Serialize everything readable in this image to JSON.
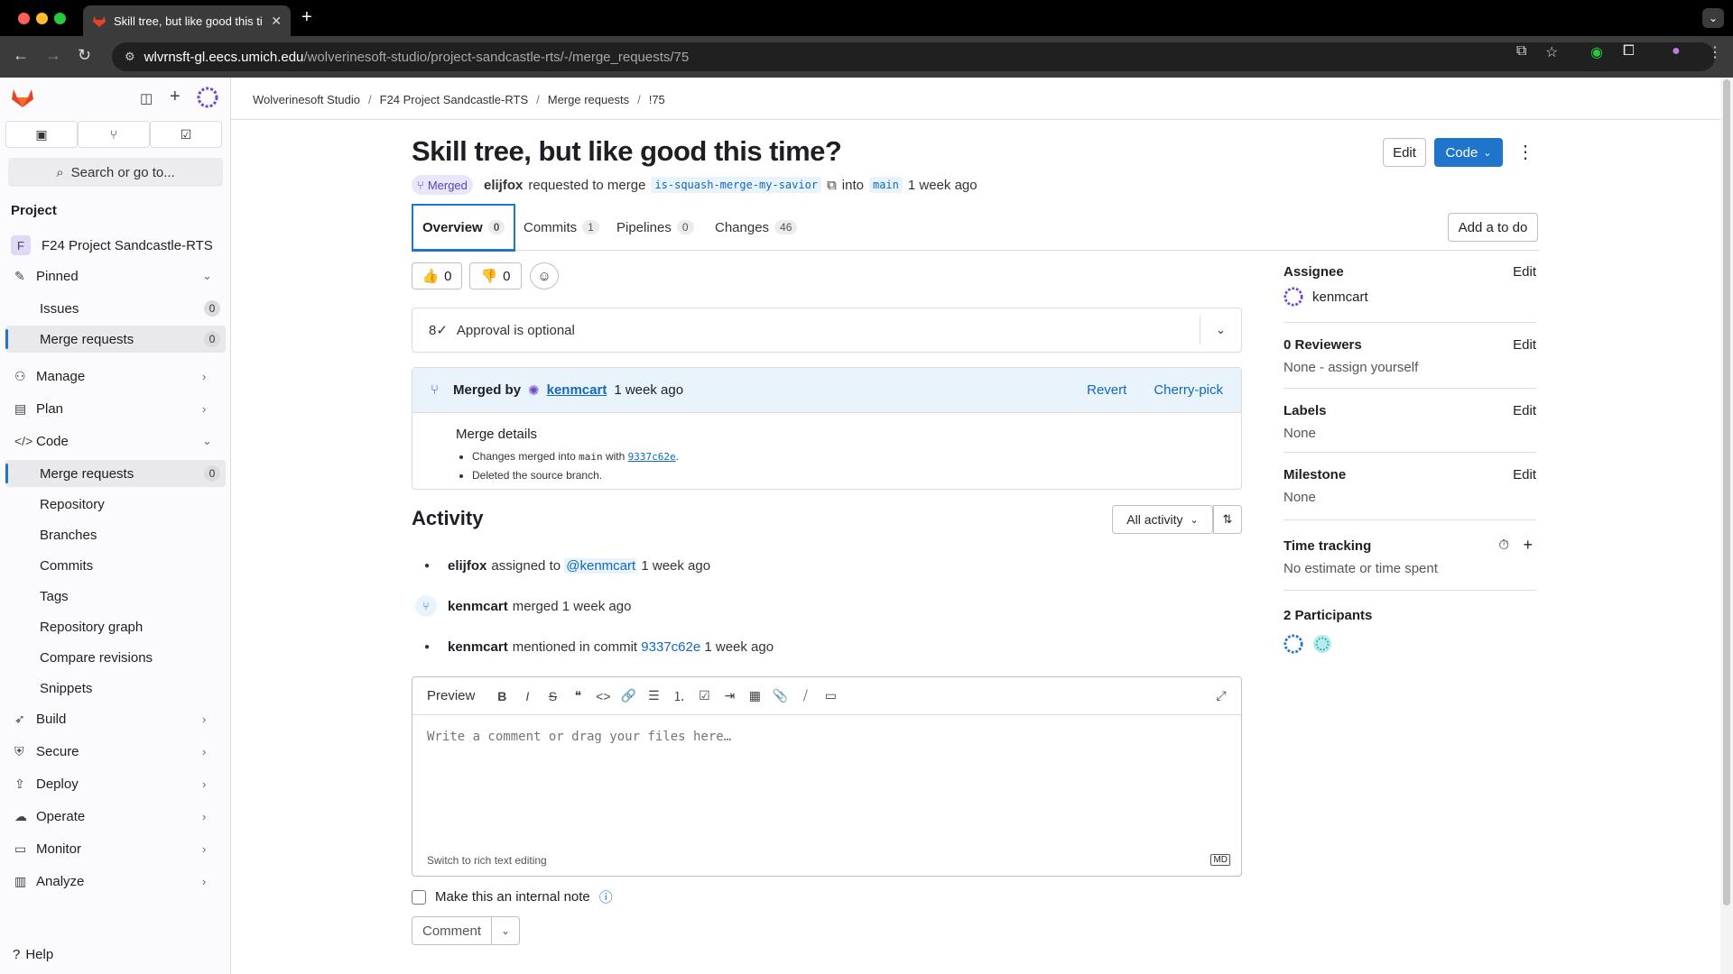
{
  "browser": {
    "tab_title": "Skill tree, but like good this ti",
    "url_host": "wlvrnsft-gl.eecs.umich.edu",
    "url_path": "/wolverinesoft-studio/project-sandcastle-rts/-/merge_requests/75"
  },
  "sidebar": {
    "search_label": "Search or go to...",
    "section_label": "Project",
    "project_initial": "F",
    "project_name": "F24 Project Sandcastle-RTS",
    "items": [
      {
        "label": "Pinned",
        "icon": "pin-icon"
      },
      {
        "label": "Issues",
        "count": "0"
      },
      {
        "label": "Merge requests",
        "count": "0"
      },
      {
        "label": "Manage",
        "icon": "users-icon"
      },
      {
        "label": "Plan",
        "icon": "calendar-icon"
      },
      {
        "label": "Code",
        "icon": "code-icon"
      },
      {
        "label": "Merge requests",
        "count": "0"
      },
      {
        "label": "Repository"
      },
      {
        "label": "Branches"
      },
      {
        "label": "Commits"
      },
      {
        "label": "Tags"
      },
      {
        "label": "Repository graph"
      },
      {
        "label": "Compare revisions"
      },
      {
        "label": "Snippets"
      },
      {
        "label": "Build",
        "icon": "rocket-icon"
      },
      {
        "label": "Secure",
        "icon": "shield-icon"
      },
      {
        "label": "Deploy",
        "icon": "deploy-icon"
      },
      {
        "label": "Operate",
        "icon": "cloud-icon"
      },
      {
        "label": "Monitor",
        "icon": "monitor-icon"
      },
      {
        "label": "Analyze",
        "icon": "chart-icon"
      }
    ],
    "help_label": "Help"
  },
  "breadcrumb": [
    "Wolverinesoft Studio",
    "F24 Project Sandcastle-RTS",
    "Merge requests",
    "!75"
  ],
  "mr": {
    "title": "Skill tree, but like good this time?",
    "status": "Merged",
    "author": "elijfox",
    "requested_text": "requested to merge",
    "source_branch": "is-squash-merge-my-savior",
    "into_text": "into",
    "target_branch": "main",
    "time": "1 week ago",
    "edit_label": "Edit",
    "code_label": "Code"
  },
  "tabs": [
    {
      "label": "Overview",
      "count": "0"
    },
    {
      "label": "Commits",
      "count": "1"
    },
    {
      "label": "Pipelines",
      "count": "0"
    },
    {
      "label": "Changes",
      "count": "46"
    }
  ],
  "add_todo_label": "Add a to do",
  "reactions": {
    "thumbs_up": "0",
    "thumbs_down": "0"
  },
  "approval_text": "Approval is optional",
  "merged": {
    "label": "Merged by",
    "user": "kenmcart",
    "time": "1 week ago",
    "revert_label": "Revert",
    "cherry_label": "Cherry-pick",
    "details_title": "Merge details",
    "detail1_prefix": "Changes merged into",
    "detail1_branch": "main",
    "detail1_with": "with",
    "detail1_commit": "9337c62e",
    "detail2": "Deleted the source branch."
  },
  "activity": {
    "title": "Activity",
    "filter_label": "All activity",
    "rows": [
      {
        "user": "elijfox",
        "text": "assigned to",
        "mention": "@kenmcart",
        "time": "1 week ago"
      },
      {
        "user": "kenmcart",
        "text": "merged 1 week ago"
      },
      {
        "user": "kenmcart",
        "text": "mentioned in commit",
        "commit": "9337c62e",
        "time": "1 week ago"
      }
    ]
  },
  "editor": {
    "preview_label": "Preview",
    "placeholder": "Write a comment or drag your files here…",
    "switch_label": "Switch to rich text editing",
    "md_label": "MD",
    "internal_note_label": "Make this an internal note",
    "comment_label": "Comment"
  },
  "right_sidebar": {
    "assignee_title": "Assignee",
    "assignee_name": "kenmcart",
    "reviewers_title": "0 Reviewers",
    "reviewers_value": "None - assign yourself",
    "labels_title": "Labels",
    "labels_value": "None",
    "milestone_title": "Milestone",
    "milestone_value": "None",
    "time_title": "Time tracking",
    "time_value": "No estimate or time spent",
    "participants_title": "2 Participants",
    "edit_label": "Edit"
  },
  "colors": {
    "accent": "#1f75cb",
    "merged_purple": "#5943b6",
    "link": "#1068bf"
  }
}
